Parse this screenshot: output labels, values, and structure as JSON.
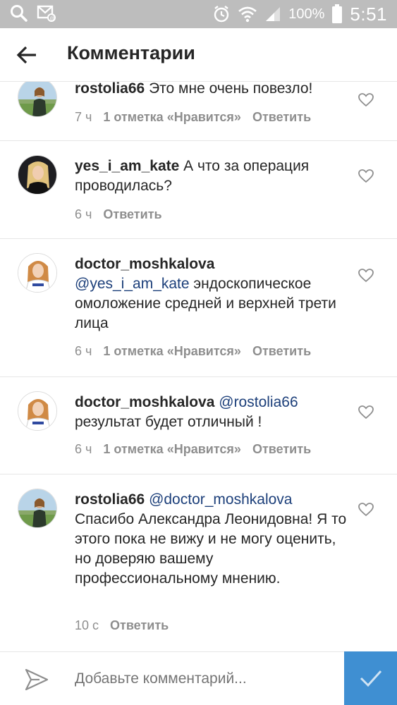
{
  "status_bar": {
    "battery_pct": "100%",
    "time": "5:51"
  },
  "header": {
    "title": "Комментарии"
  },
  "comments": [
    {
      "username": "rostolia66",
      "mention": "",
      "text": "Это мне очень повезло!",
      "time": "7 ч",
      "likes": "1 отметка «Нравится»",
      "reply": "Ответить"
    },
    {
      "username": "yes_i_am_kate",
      "mention": "",
      "text": "А что за операция проводилась?",
      "time": "6 ч",
      "likes": "",
      "reply": "Ответить"
    },
    {
      "username": "doctor_moshkalova",
      "mention": "@yes_i_am_kate",
      "text": "эндоскопическое омоложение средней и верхней трети лица",
      "time": "6 ч",
      "likes": "1 отметка «Нравится»",
      "reply": "Ответить"
    },
    {
      "username": "doctor_moshkalova",
      "mention": "@rostolia66",
      "text": "результат будет отличный !",
      "time": "6 ч",
      "likes": "1 отметка «Нравится»",
      "reply": "Ответить"
    },
    {
      "username": "rostolia66",
      "mention": "@doctor_moshkalova",
      "text": "Спасибо Александра Леонидовна! Я то этого пока не вижу и не могу оценить, но доверяю вашему профессиональному мнению.",
      "time": "10 с",
      "likes": "",
      "reply": "Ответить"
    }
  ],
  "composer": {
    "placeholder": "Добавьте комментарий..."
  },
  "colors": {
    "status_bar": "#bdbdbd",
    "mention": "#1c3f7a",
    "post_button": "#3f8fd2",
    "meta": "#8e8e8e"
  }
}
